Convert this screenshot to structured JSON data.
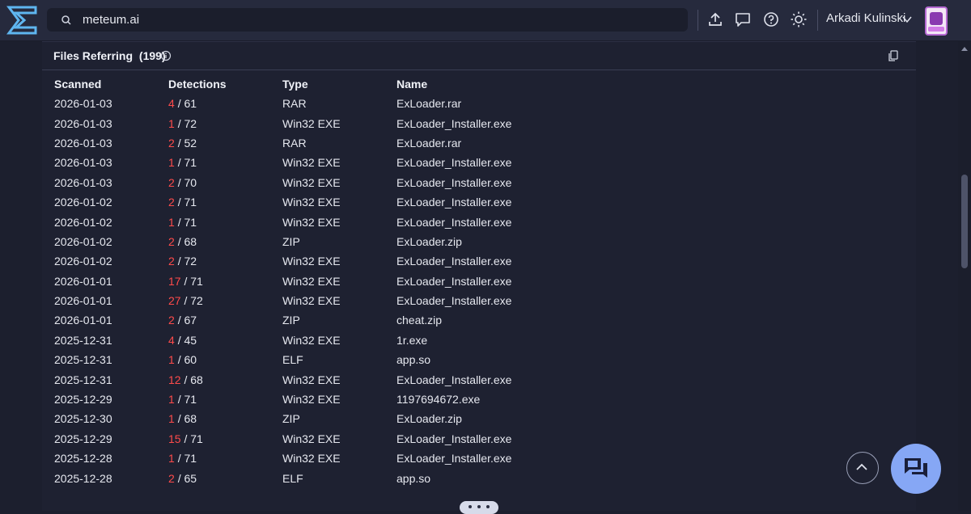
{
  "topbar": {
    "search_value": "meteum.ai",
    "user_name": "Arkadi Kulinski"
  },
  "section": {
    "title": "Files Referring",
    "count": "(199)"
  },
  "table": {
    "headers": [
      "Scanned",
      "Detections",
      "Type",
      "Name"
    ],
    "rows": [
      {
        "scanned": "2026-01-03",
        "pos": "4",
        "total": "/ 61",
        "type": "RAR",
        "name": "ExLoader.rar"
      },
      {
        "scanned": "2026-01-03",
        "pos": "1",
        "total": "/ 72",
        "type": "Win32 EXE",
        "name": "ExLoader_Installer.exe"
      },
      {
        "scanned": "2026-01-03",
        "pos": "2",
        "total": "/ 52",
        "type": "RAR",
        "name": "ExLoader.rar"
      },
      {
        "scanned": "2026-01-03",
        "pos": "1",
        "total": "/ 71",
        "type": "Win32 EXE",
        "name": "ExLoader_Installer.exe"
      },
      {
        "scanned": "2026-01-03",
        "pos": "2",
        "total": "/ 70",
        "type": "Win32 EXE",
        "name": "ExLoader_Installer.exe"
      },
      {
        "scanned": "2026-01-02",
        "pos": "2",
        "total": "/ 71",
        "type": "Win32 EXE",
        "name": "ExLoader_Installer.exe"
      },
      {
        "scanned": "2026-01-02",
        "pos": "1",
        "total": "/ 71",
        "type": "Win32 EXE",
        "name": "ExLoader_Installer.exe"
      },
      {
        "scanned": "2026-01-02",
        "pos": "2",
        "total": "/ 68",
        "type": "ZIP",
        "name": "ExLoader.zip"
      },
      {
        "scanned": "2026-01-02",
        "pos": "2",
        "total": "/ 72",
        "type": "Win32 EXE",
        "name": "ExLoader_Installer.exe"
      },
      {
        "scanned": "2026-01-01",
        "pos": "17",
        "total": "/ 71",
        "type": "Win32 EXE",
        "name": "ExLoader_Installer.exe"
      },
      {
        "scanned": "2026-01-01",
        "pos": "27",
        "total": "/ 72",
        "type": "Win32 EXE",
        "name": "ExLoader_Installer.exe"
      },
      {
        "scanned": "2026-01-01",
        "pos": "2",
        "total": "/ 67",
        "type": "ZIP",
        "name": "cheat.zip"
      },
      {
        "scanned": "2025-12-31",
        "pos": "4",
        "total": "/ 45",
        "type": "Win32 EXE",
        "name": "1r.exe"
      },
      {
        "scanned": "2025-12-31",
        "pos": "1",
        "total": "/ 60",
        "type": "ELF",
        "name": "app.so"
      },
      {
        "scanned": "2025-12-31",
        "pos": "12",
        "total": "/ 68",
        "type": "Win32 EXE",
        "name": "ExLoader_Installer.exe"
      },
      {
        "scanned": "2025-12-29",
        "pos": "1",
        "total": "/ 71",
        "type": "Win32 EXE",
        "name": "1197694672.exe"
      },
      {
        "scanned": "2025-12-30",
        "pos": "1",
        "total": "/ 68",
        "type": "ZIP",
        "name": "ExLoader.zip"
      },
      {
        "scanned": "2025-12-29",
        "pos": "15",
        "total": "/ 71",
        "type": "Win32 EXE",
        "name": "ExLoader_Installer.exe"
      },
      {
        "scanned": "2025-12-28",
        "pos": "1",
        "total": "/ 71",
        "type": "Win32 EXE",
        "name": "ExLoader_Installer.exe"
      },
      {
        "scanned": "2025-12-28",
        "pos": "2",
        "total": "/ 65",
        "type": "ELF",
        "name": "app.so"
      }
    ]
  },
  "colors": {
    "background": "#1c1f2e",
    "topbar": "#262a3d",
    "positive_detection": "#ff4b4b",
    "chat_button": "#86a7f5"
  },
  "icons": [
    "logo-icon",
    "search-icon",
    "upload-icon",
    "chat-icon",
    "help-icon",
    "theme-icon",
    "chevron-down-icon",
    "info-icon",
    "copy-icon",
    "arrow-up-icon",
    "chat-bubble-icon",
    "more-dots-icon"
  ]
}
